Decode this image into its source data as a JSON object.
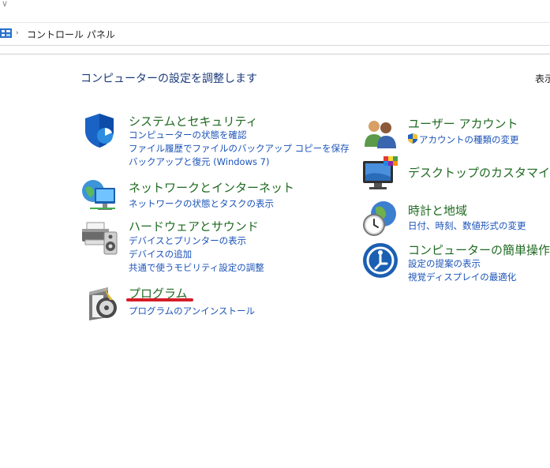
{
  "top": {
    "glyph": "∨"
  },
  "address_bar": {
    "path": "コントロール パネル",
    "arrow": "›"
  },
  "heading": "コンピューターの設定を調整します",
  "view_by": "表示",
  "left_column": [
    {
      "title": "システムとセキュリティ",
      "links": [
        "コンピューターの状態を確認",
        "ファイル履歴でファイルのバックアップ コピーを保存",
        "バックアップと復元 (Windows 7)"
      ]
    },
    {
      "title": "ネットワークとインターネット",
      "links": [
        "ネットワークの状態とタスクの表示"
      ]
    },
    {
      "title": "ハードウェアとサウンド",
      "links": [
        "デバイスとプリンターの表示",
        "デバイスの追加",
        "共通で使うモビリティ設定の調整"
      ]
    },
    {
      "title": "プログラム",
      "links": [
        "プログラムのアンインストール"
      ]
    }
  ],
  "right_column": [
    {
      "title": "ユーザー アカウント",
      "links": [
        "アカウントの種類の変更"
      ]
    },
    {
      "title": "デスクトップのカスタマイズ",
      "links": []
    },
    {
      "title": "時計と地域",
      "links": [
        "日付、時刻、数値形式の変更"
      ]
    },
    {
      "title": "コンピューターの簡単操作",
      "links": [
        "設定の提案の表示",
        "視覚ディスプレイの最適化"
      ]
    }
  ],
  "colors": {
    "title_green": "#1f6a21",
    "link_blue": "#1b53b8",
    "heading_blue": "#1a3a7a",
    "annotation_red": "#d41d28"
  },
  "icons": [
    "shield-icon",
    "network-globe-icon",
    "printer-icon",
    "program-box-icon",
    "users-icon",
    "monitor-icon",
    "clock-globe-icon",
    "ease-of-access-icon",
    "uac-shield-icon"
  ]
}
